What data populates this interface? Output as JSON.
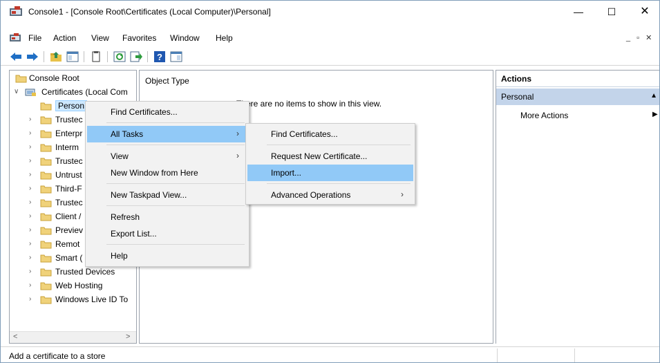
{
  "window": {
    "title": "Console1 - [Console Root\\Certificates (Local Computer)\\Personal]",
    "controls": {
      "minimize": "—",
      "maximize": "☐",
      "close": "✕"
    }
  },
  "menubar": {
    "items": [
      "File",
      "Action",
      "View",
      "Favorites",
      "Window",
      "Help"
    ],
    "mdi_controls": "_ ▫ ✕"
  },
  "toolbar": {
    "buttons": [
      "back-icon",
      "forward-icon",
      "up-folder-icon",
      "show-hide-tree-icon",
      "properties-icon",
      "refresh-icon",
      "export-icon",
      "help-icon",
      "console-tree-icon"
    ]
  },
  "tree": {
    "items": [
      {
        "label": "Console Root",
        "expander": ""
      },
      {
        "label": "Certificates (Local Com",
        "expander": "∨"
      },
      {
        "label": "Person",
        "expander": ""
      },
      {
        "label": "Trustec",
        "expander": "›"
      },
      {
        "label": "Enterpr",
        "expander": "›"
      },
      {
        "label": "Interm",
        "expander": "›"
      },
      {
        "label": "Trustec",
        "expander": "›"
      },
      {
        "label": "Untrust",
        "expander": "›"
      },
      {
        "label": "Third-F",
        "expander": "›"
      },
      {
        "label": "Trustec",
        "expander": "›"
      },
      {
        "label": "Client /",
        "expander": "›"
      },
      {
        "label": "Previev",
        "expander": "›"
      },
      {
        "label": "Remot",
        "expander": "›"
      },
      {
        "label": "Smart (",
        "expander": "›"
      },
      {
        "label": "Trusted Devices",
        "expander": "›"
      },
      {
        "label": "Web Hosting",
        "expander": "›"
      },
      {
        "label": "Windows Live ID To",
        "expander": "›"
      }
    ],
    "scroll_left": "<",
    "scroll_right": ">"
  },
  "center": {
    "column_header": "Object Type",
    "empty_message": "There are no items to show in this view."
  },
  "actions": {
    "header": "Actions",
    "section": "Personal",
    "section_arrow": "▲",
    "item": "More Actions",
    "item_arrow": "▶"
  },
  "context_menu": {
    "items": [
      {
        "label": "Find Certificates...",
        "submenu": ""
      },
      {
        "label": "All Tasks",
        "submenu": "›"
      },
      {
        "label": "View",
        "submenu": "›"
      },
      {
        "label": "New Window from Here",
        "submenu": ""
      },
      {
        "label": "New Taskpad View...",
        "submenu": ""
      },
      {
        "label": "Refresh",
        "submenu": ""
      },
      {
        "label": "Export List...",
        "submenu": ""
      },
      {
        "label": "Help",
        "submenu": ""
      }
    ],
    "highlighted": "All Tasks"
  },
  "submenu": {
    "items": [
      {
        "label": "Find Certificates...",
        "submenu": ""
      },
      {
        "label": "Request New Certificate...",
        "submenu": ""
      },
      {
        "label": "Import...",
        "submenu": ""
      },
      {
        "label": "Advanced Operations",
        "submenu": "›"
      }
    ],
    "highlighted": "Import..."
  },
  "status": {
    "text": "Add a certificate to a store"
  },
  "colors": {
    "highlight": "#91c9f7",
    "selection": "#cde8ff",
    "actions_section": "#c3d4ea",
    "menu_bg": "#f2f2f2"
  }
}
